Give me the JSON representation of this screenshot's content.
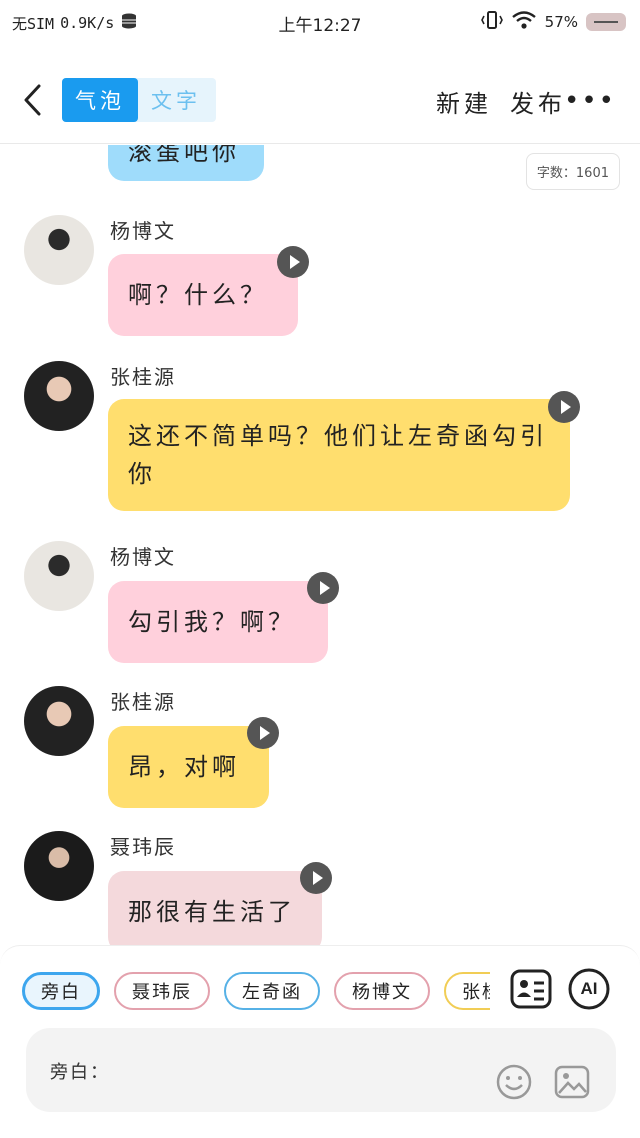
{
  "status_bar": {
    "carrier": "无SIM",
    "speed": "0.9K/s",
    "time": "上午12:27",
    "battery": "57%"
  },
  "header": {
    "tabs": [
      {
        "label": "气泡",
        "active": true
      },
      {
        "label": "文字",
        "active": false
      }
    ],
    "new_label": "新建",
    "publish_label": "发布",
    "more_label": "•••"
  },
  "chat": {
    "word_count": "字数：1601",
    "partial_message": "滚蛋吧你",
    "messages": [
      {
        "sender": "杨博文",
        "text": "啊？什么？",
        "color": "#ffd0dc"
      },
      {
        "sender": "张桂源",
        "text": "这还不简单吗？他们让左奇函勾引你",
        "color": "#ffde6e"
      },
      {
        "sender": "杨博文",
        "text": "勾引我？啊？",
        "color": "#ffd0dc"
      },
      {
        "sender": "张桂源",
        "text": "昂，对啊",
        "color": "#ffde6e"
      },
      {
        "sender": "聂玮辰",
        "text": "那很有生活了",
        "color": "#f4d9dc"
      }
    ]
  },
  "composer": {
    "characters": [
      "旁白",
      "聂玮辰",
      "左奇函",
      "杨博文",
      "张桂源"
    ],
    "ai_label": "AI",
    "input_label": "旁白："
  },
  "colors": {
    "accent": "#1a9bef",
    "pink_bubble": "#ffd0dc",
    "yellow_bubble": "#ffde6e",
    "blue_bubble": "#9fdcfb"
  }
}
